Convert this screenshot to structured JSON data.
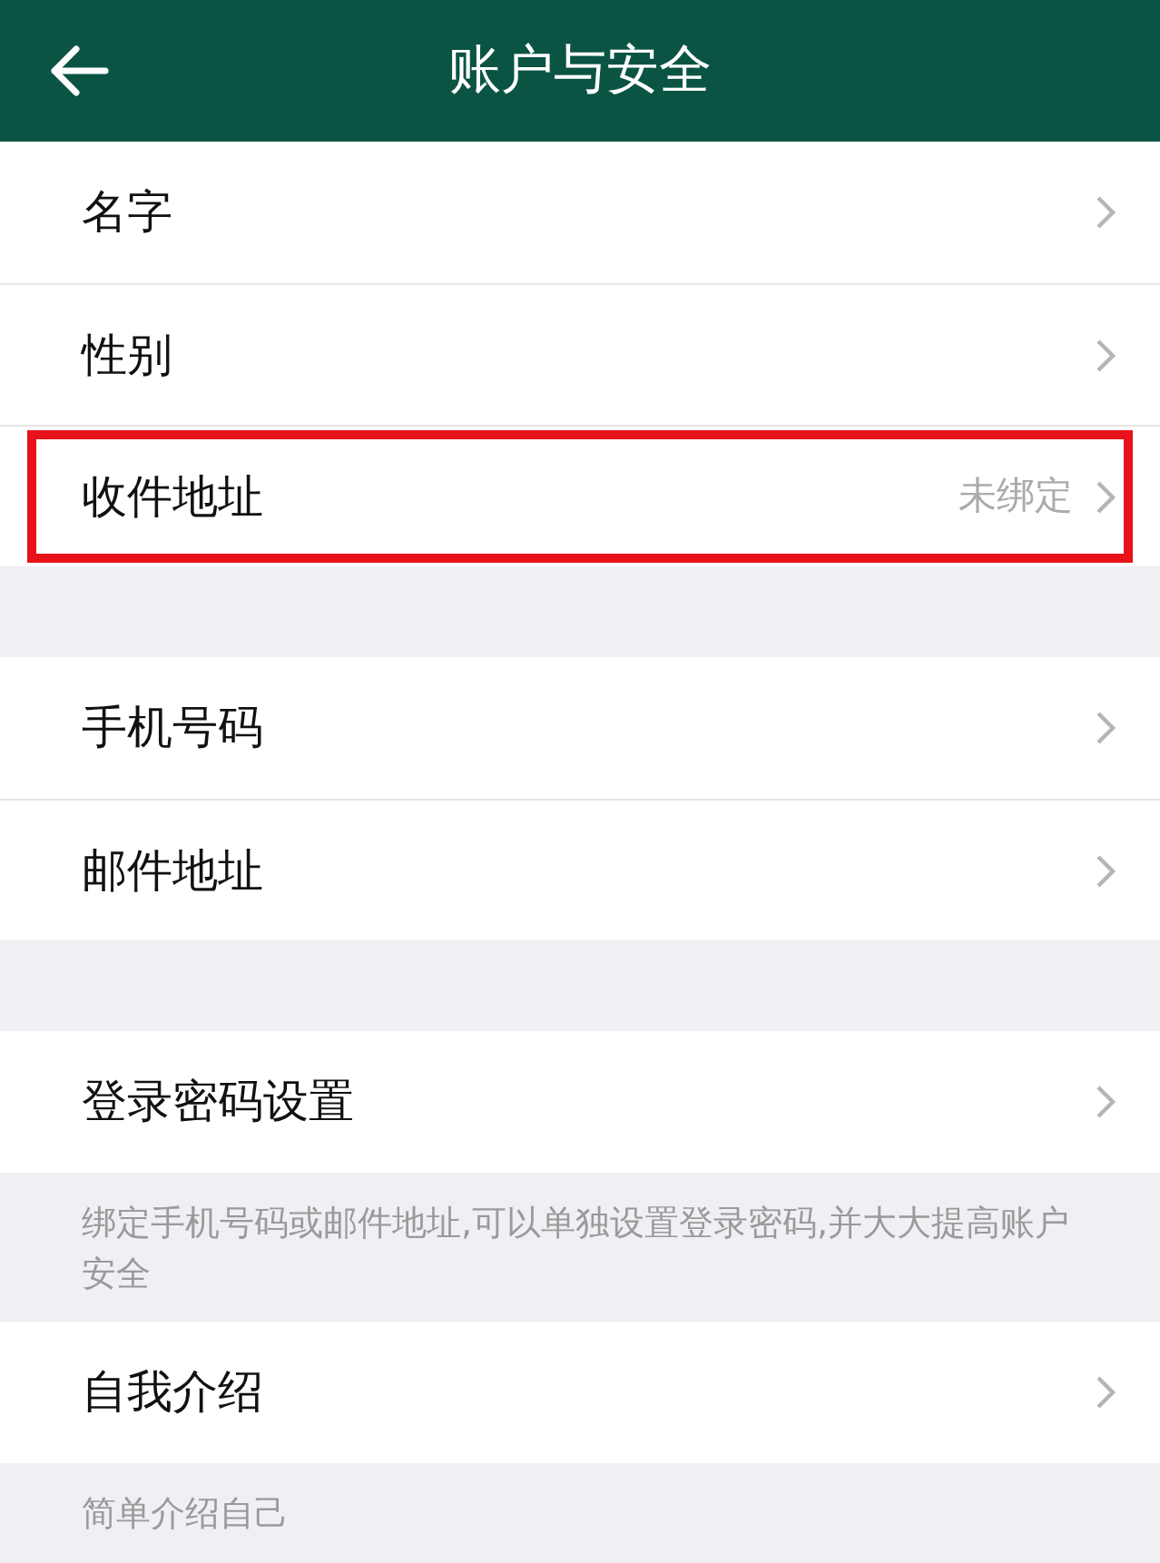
{
  "header": {
    "title": "账户与安全"
  },
  "sections": [
    {
      "items": [
        {
          "label": "名字",
          "highlighted": false
        },
        {
          "label": "性别",
          "highlighted": false
        },
        {
          "label": "收件地址",
          "value": "未绑定",
          "highlighted": true
        }
      ]
    },
    {
      "items": [
        {
          "label": "手机号码",
          "highlighted": false
        },
        {
          "label": "邮件地址",
          "highlighted": false
        }
      ]
    },
    {
      "items": [
        {
          "label": "登录密码设置",
          "highlighted": false
        }
      ],
      "note": "绑定手机号码或邮件地址,可以单独设置登录密码,并大大提高账户安全"
    },
    {
      "items": [
        {
          "label": "自我介绍",
          "highlighted": false
        }
      ],
      "note": "简单介绍自己"
    }
  ]
}
